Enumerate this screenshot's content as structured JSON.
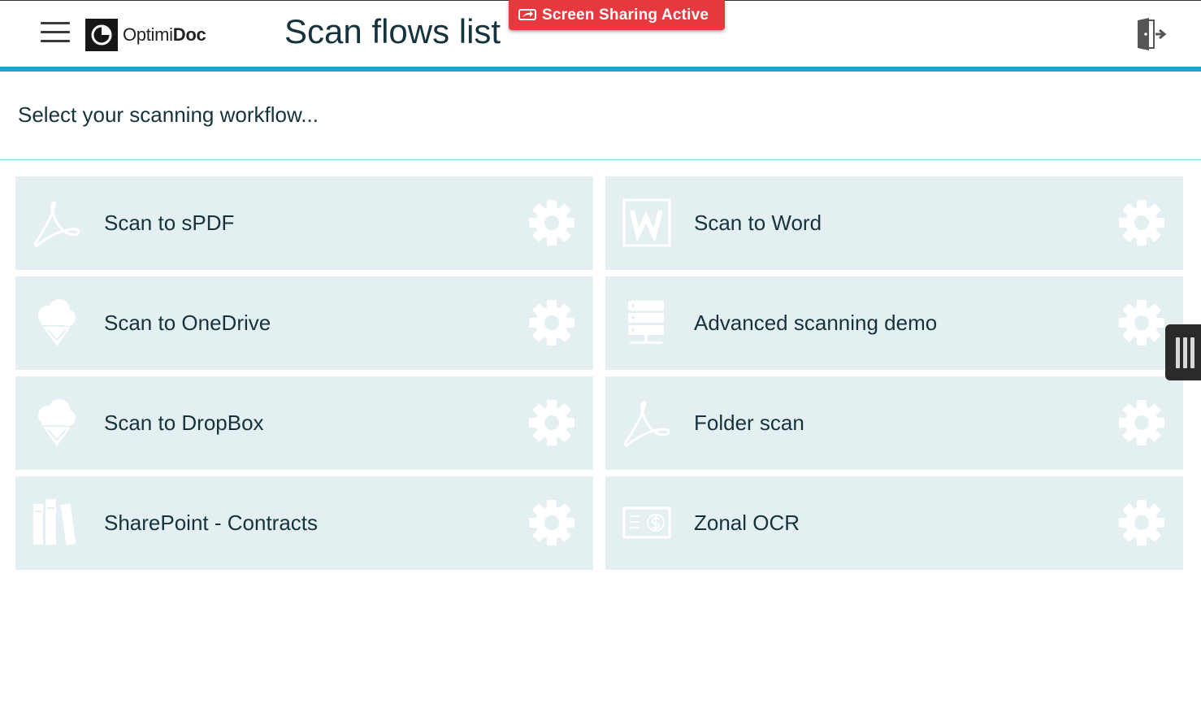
{
  "banner": {
    "label": "Screen Sharing Active"
  },
  "header": {
    "logo_prefix": "Optimi",
    "logo_suffix": "Doc",
    "title": "Scan flows list"
  },
  "subtitle": "Select your scanning workflow...",
  "flows": [
    {
      "label": "Scan to sPDF",
      "icon": "pdf-icon"
    },
    {
      "label": "Scan to Word",
      "icon": "word-icon"
    },
    {
      "label": "Scan to OneDrive",
      "icon": "cloud-download-icon"
    },
    {
      "label": "Advanced scanning demo",
      "icon": "network-server-icon"
    },
    {
      "label": "Scan to DropBox",
      "icon": "cloud-download-icon"
    },
    {
      "label": "Folder scan",
      "icon": "pdf-icon"
    },
    {
      "label": "SharePoint - Contracts",
      "icon": "books-icon"
    },
    {
      "label": "Zonal OCR",
      "icon": "money-document-icon"
    }
  ],
  "colors": {
    "accent": "#14a8d4",
    "tile_bg": "#e4eff1",
    "banner": "#e6393f",
    "text": "#16333d"
  }
}
